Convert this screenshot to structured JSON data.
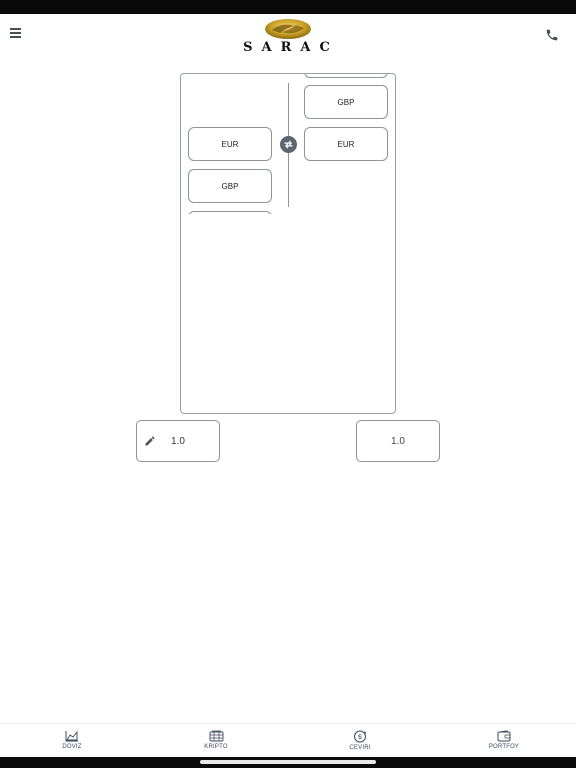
{
  "header": {
    "logo_text": "SARAC",
    "menu_icon": "menu-icon",
    "phone_icon": "phone-icon"
  },
  "converter": {
    "to_list": [
      {
        "label": ""
      },
      {
        "label": "GBP"
      },
      {
        "label": "EUR"
      }
    ],
    "from_list": [
      {
        "label": "EUR"
      },
      {
        "label": "GBP"
      },
      {
        "label": ""
      }
    ],
    "swap_icon": "swap-icon"
  },
  "amounts": {
    "from_value": "1.0",
    "to_value": "1.0"
  },
  "nav": {
    "items": [
      {
        "label": "DOVIZ",
        "icon": "area-chart-icon"
      },
      {
        "label": "KRIPTO",
        "icon": "crypto-icon"
      },
      {
        "label": "CEVIRI",
        "icon": "exchange-icon"
      },
      {
        "label": "PORTFOY",
        "icon": "wallet-icon"
      }
    ]
  },
  "colors": {
    "border": "#8e949a",
    "swap_bg": "#5d6773",
    "logo_gold": "#c9a227"
  }
}
